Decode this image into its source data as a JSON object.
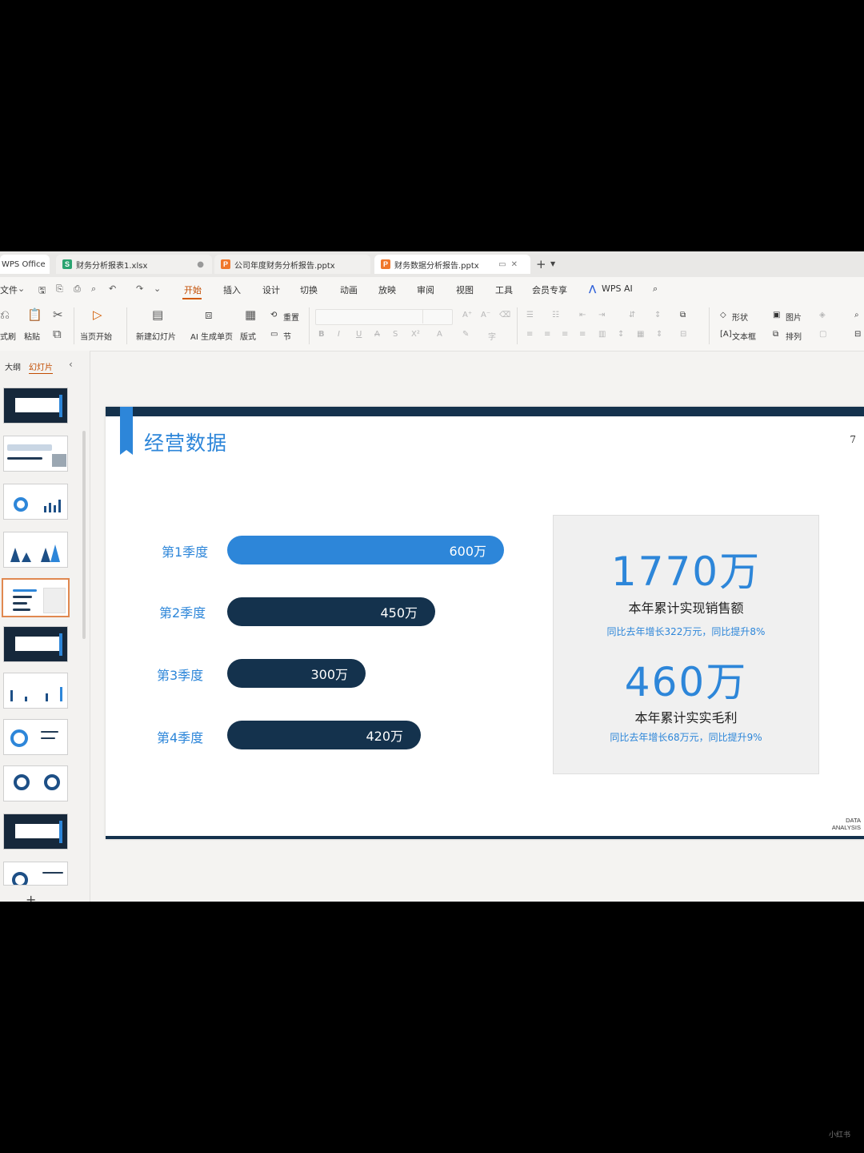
{
  "tabs": {
    "home": "WPS Office",
    "t1": "财务分析报表1.xlsx",
    "t2": "公司年度财务分析报告.pptx",
    "t3": "财务数据分析报告.pptx",
    "add": "+"
  },
  "menu": {
    "file": "文件",
    "items": [
      "开始",
      "插入",
      "设计",
      "切换",
      "动画",
      "放映",
      "审阅",
      "视图",
      "工具",
      "会员专享"
    ],
    "wps_ai": "WPS AI"
  },
  "ribbon": {
    "format_painter": "式刷",
    "paste": "粘贴",
    "play_from_current": "当页开始",
    "new_slide": "新建幻灯片",
    "ai_page": "AI 生成单页",
    "layout": "版式",
    "reset": "重置",
    "section": "节",
    "shape": "形状",
    "picture": "图片",
    "textbox": "文本框",
    "arrange": "排列"
  },
  "left_panel": {
    "outline_tab": "大纲",
    "slides_tab": "幻灯片",
    "add": "+"
  },
  "slide": {
    "title": "经营数据",
    "page_number": "7",
    "corner_line1": "DATA",
    "corner_line2": "ANALYSIS",
    "quarters": [
      {
        "label": "第1季度",
        "value_label": "600万",
        "value": 600
      },
      {
        "label": "第2季度",
        "value_label": "450万",
        "value": 450
      },
      {
        "label": "第3季度",
        "value_label": "300万",
        "value": 300
      },
      {
        "label": "第4季度",
        "value_label": "420万",
        "value": 420
      }
    ],
    "card": {
      "sales_value": "1770万",
      "sales_label": "本年累计实现销售额",
      "sales_note": "同比去年增长322万元，同比提升8%",
      "profit_value": "460万",
      "profit_label": "本年累计实实毛利",
      "profit_note": "同比去年增长68万元，同比提升9%"
    }
  },
  "colors": {
    "accent": "#2d86d9",
    "navy": "#14324d",
    "active_menu": "#c24c00"
  },
  "watermark": "小红书"
}
